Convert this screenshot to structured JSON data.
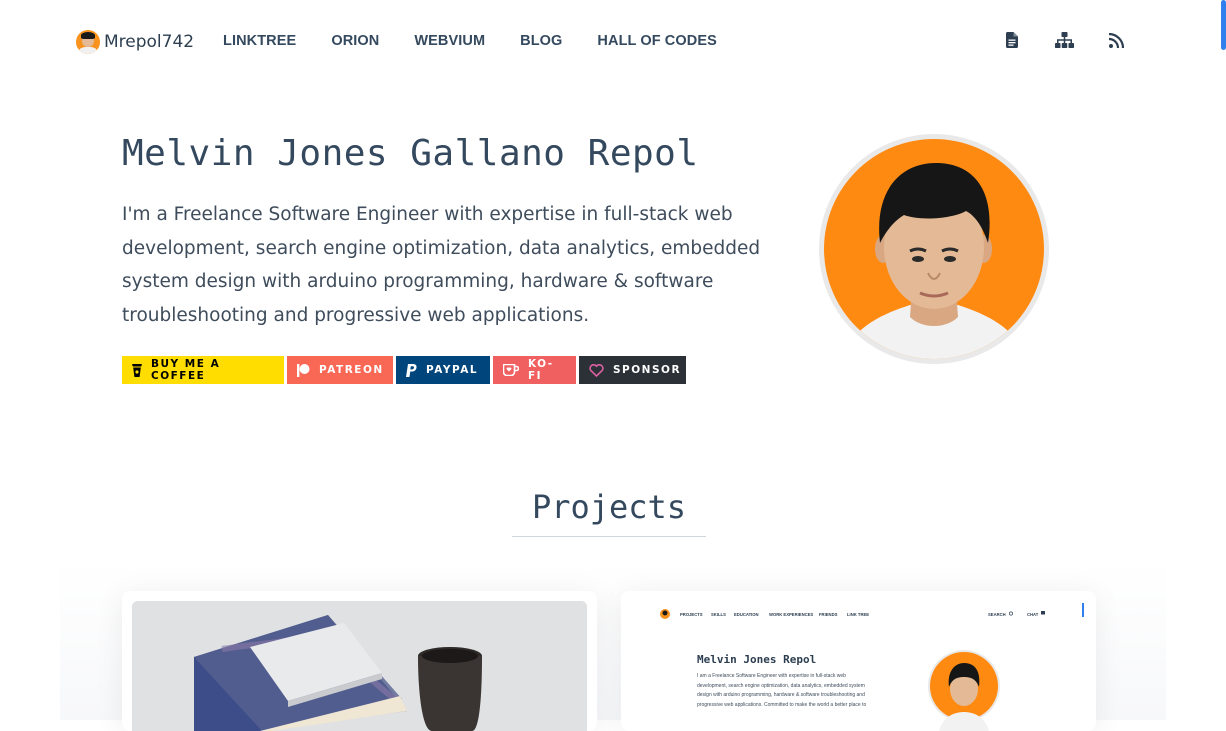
{
  "brand": {
    "name": "Mrepol742"
  },
  "nav": {
    "links": [
      "LINKTREE",
      "ORION",
      "WEBVIUM",
      "BLOG",
      "HALL OF CODES"
    ],
    "icons": [
      "document-icon",
      "sitemap-icon",
      "rss-icon"
    ]
  },
  "hero": {
    "title": "Melvin Jones Gallano Repol",
    "description": "I'm a Freelance Software Engineer with expertise in full-stack web development, search engine optimization, data analytics, embedded system design with arduino programming, hardware & software troubleshooting and progressive web applications."
  },
  "donate": {
    "buttons": [
      {
        "label": "BUY ME A COFFEE",
        "icon": "coffee-icon",
        "color": "#ffdd00"
      },
      {
        "label": "PATREON",
        "icon": "patreon-icon",
        "color": "#f96854"
      },
      {
        "label": "PAYPAL",
        "icon": "paypal-icon",
        "color": "#00457c"
      },
      {
        "label": "KO-FI",
        "icon": "kofi-cup-icon",
        "color": "#f16061"
      },
      {
        "label": "SPONSOR",
        "icon": "heart-icon",
        "color": "#2b3137"
      }
    ]
  },
  "projects": {
    "title": "Projects",
    "preview": {
      "nav_links": [
        "PROJECTS",
        "SKILLS",
        "EDUCATION",
        "WORK EXPERIENCES",
        "FRIENDS",
        "LINK TREE"
      ],
      "search": "SEARCH",
      "chat": "CHAT",
      "title": "Melvin Jones Repol",
      "lines": [
        "I am a Freelance Software Engineer with expertise in full-stack web",
        "development, search engine optimization, data analytics, embedded system",
        "design with arduino programming, hardware & software troubleshooting and",
        "progressive web applications. Committed to make the world a better place to"
      ]
    }
  },
  "colors": {
    "accent": "#2f80ed",
    "photo_bg": "#ff8a12",
    "text": "#34495e"
  }
}
